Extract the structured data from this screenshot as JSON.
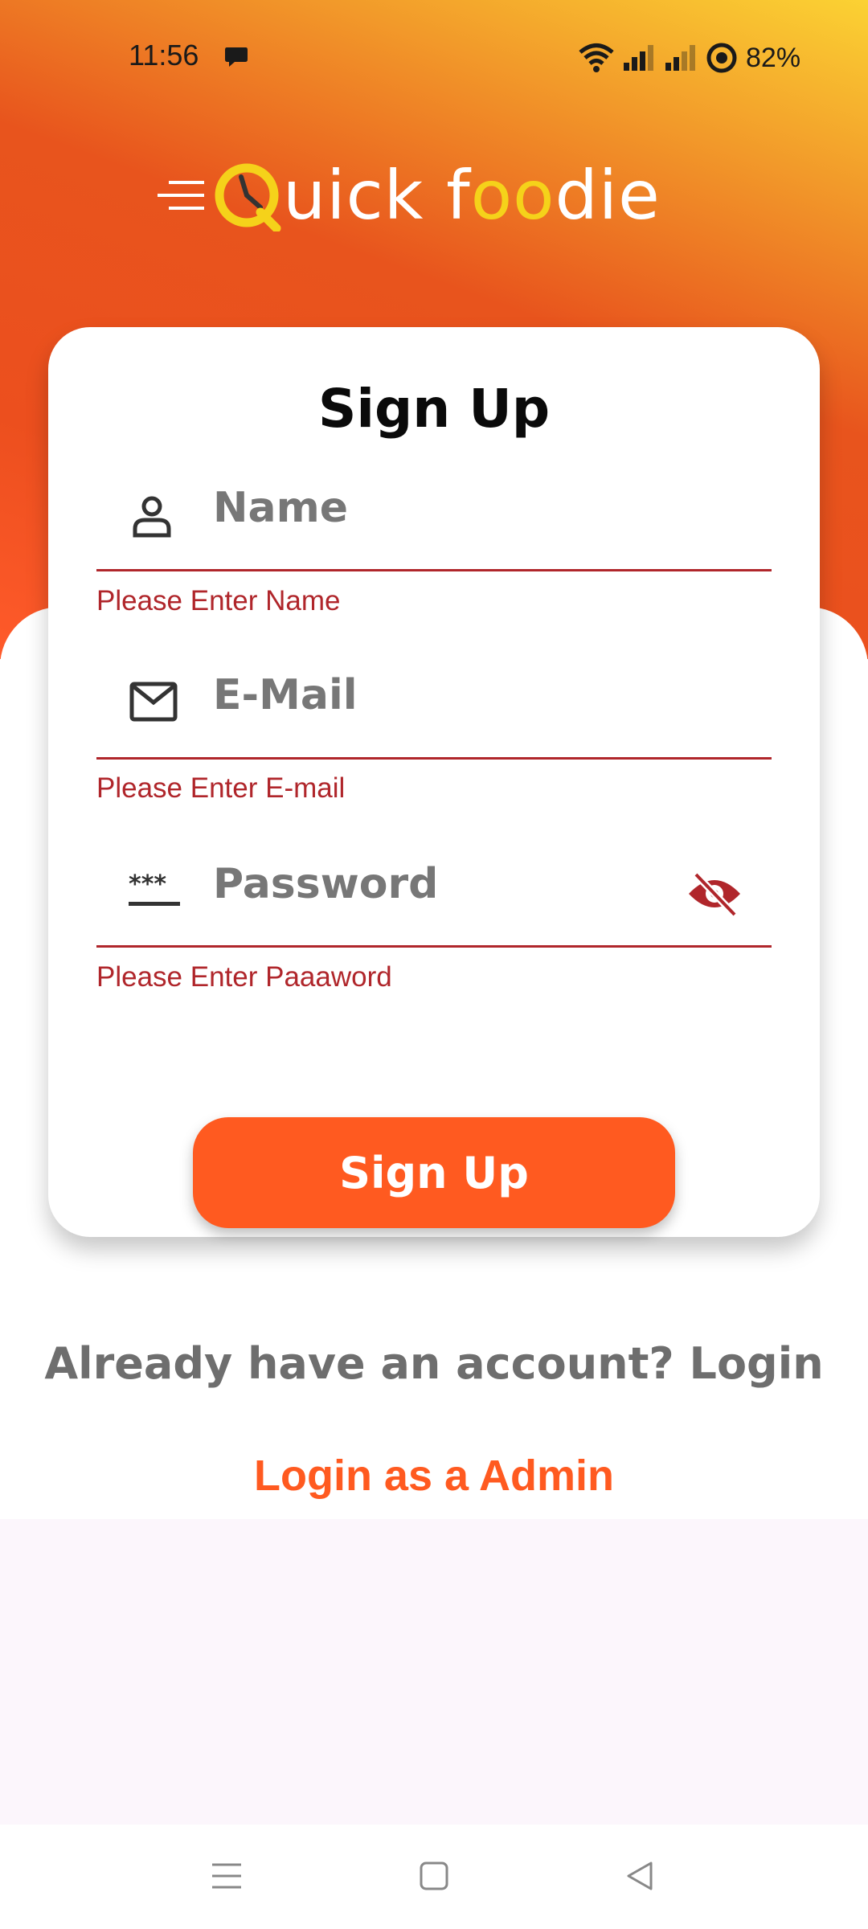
{
  "status_bar": {
    "time": "11:56",
    "battery": "82%",
    "icons": [
      "chat-bubble-icon",
      "wifi-icon",
      "signal-icon",
      "signal-icon",
      "data-saver-icon"
    ]
  },
  "logo": {
    "name_part1": "uick ",
    "name_part2": "f",
    "name_part3": "oo",
    "name_part4": "die",
    "brand_colors": {
      "yellow": "#f5d21a",
      "white": "#ffffff"
    }
  },
  "form": {
    "title": "Sign Up",
    "fields": [
      {
        "placeholder": "Name",
        "icon": "person-icon",
        "error": "Please Enter Name"
      },
      {
        "placeholder": "E-Mail",
        "icon": "mail-icon",
        "error": "Please Enter E-mail"
      },
      {
        "placeholder": "Password",
        "icon": "password-icon",
        "error": "Please Enter Paaaword",
        "toggle_icon": "eye-off-icon"
      }
    ],
    "submit_label": "Sign Up"
  },
  "footer": {
    "login_prompt": "Already have an account? Login",
    "admin_link": "Login as a Admin"
  },
  "nav_bar": {
    "buttons": [
      "menu-icon",
      "home-icon",
      "back-icon"
    ]
  },
  "colors": {
    "accent": "#ff5a20",
    "error": "#b0262b",
    "gradient_top": "#fbd233",
    "gradient_mid": "#e8541d"
  }
}
